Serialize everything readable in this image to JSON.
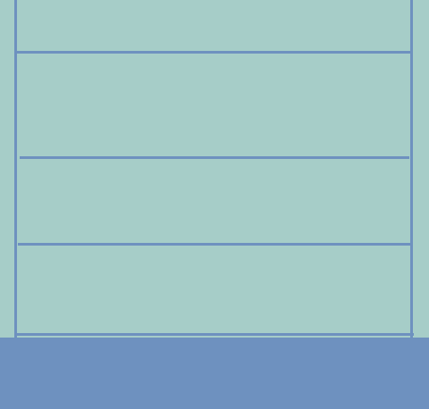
{
  "colors": {
    "background": "#a6cdc8",
    "lines": "#6e91bf",
    "ground": "#6e91bf"
  }
}
